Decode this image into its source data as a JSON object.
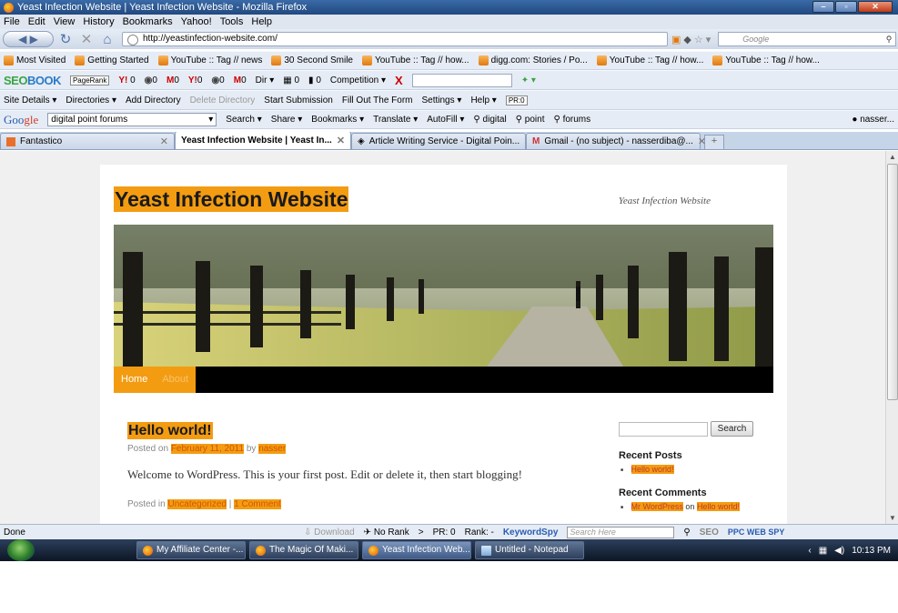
{
  "window": {
    "title": "Yeast Infection Website | Yeast Infection Website - Mozilla Firefox"
  },
  "menu": [
    "File",
    "Edit",
    "View",
    "History",
    "Bookmarks",
    "Yahoo!",
    "Tools",
    "Help"
  ],
  "nav": {
    "url": "http://yeastinfection-website.com/",
    "search_placeholder": "Google"
  },
  "bookmarks": [
    "Most Visited",
    "Getting Started",
    "YouTube :: Tag // news",
    "30 Second Smile",
    "YouTube :: Tag // how...",
    "digg.com: Stories / Po...",
    "YouTube :: Tag // how...",
    "YouTube :: Tag // how..."
  ],
  "seobook": {
    "logo_a": "SEO",
    "logo_b": "BOOK",
    "pagerank": "PageRank",
    "items": [
      "0",
      "0",
      "0",
      "0",
      "0",
      "0"
    ],
    "dir": "Dir",
    "comp": "Competition",
    "n1": "0",
    "n2": "0"
  },
  "sitedetails": {
    "items": [
      "Site Details",
      "Directories",
      "Add Directory",
      "Delete Directory",
      "Start Submission",
      "Fill Out The Form",
      "Settings",
      "Help"
    ],
    "pr": "PR:0"
  },
  "googlebar": {
    "logo_a": "Goo",
    "logo_b": "gle",
    "query": "digital point forums",
    "items": [
      "Search",
      "Share",
      "Bookmarks",
      "Translate",
      "AutoFill",
      "digital",
      "point",
      "forums"
    ],
    "user": "nasser..."
  },
  "tabs": [
    {
      "label": "Fantastico"
    },
    {
      "label": "Yeast Infection Website | Yeast In..."
    },
    {
      "label": "Article Writing Service - Digital Poin..."
    },
    {
      "label": "Gmail - (no subject) - nasserdiba@..."
    }
  ],
  "site": {
    "title": "Yeast Infection Website",
    "description": "Yeast Infection Website",
    "menu": [
      "Home",
      "About"
    ]
  },
  "post": {
    "title": "Hello world!",
    "posted_on": "Posted on",
    "date": "February 11, 2011",
    "by": "by",
    "author": "nasser",
    "content": "Welcome to WordPress. This is your first post. Edit or delete it, then start blogging!",
    "posted_in": "Posted in",
    "category": "Uncategorized",
    "sep": "|",
    "comments": "1 Comment"
  },
  "sidebar": {
    "search_button": "Search",
    "recent_posts_title": "Recent Posts",
    "recent_post": "Hello world!",
    "recent_comments_title": "Recent Comments",
    "comment_author": "Mr WordPress",
    "comment_on": "on",
    "comment_post": "Hello world!"
  },
  "status": {
    "text": "Done",
    "download": "Download",
    "norank": "No Rank",
    "pr": "PR: 0",
    "rank": "Rank: -",
    "keywordspy": "KeywordSpy",
    "ks_placeholder": "Search Here",
    "seo": "SEO",
    "ppc": "PPC WEB SPY"
  },
  "taskbar": {
    "tasks": [
      "My Affiliate Center -...",
      "The Magic Of Maki...",
      "Yeast Infection Web...",
      "Untitled - Notepad"
    ],
    "time": "10:13 PM"
  },
  "colors": {
    "accent": "#f39c12",
    "titlebar": "#21497e",
    "menu_bg": "#000000"
  }
}
